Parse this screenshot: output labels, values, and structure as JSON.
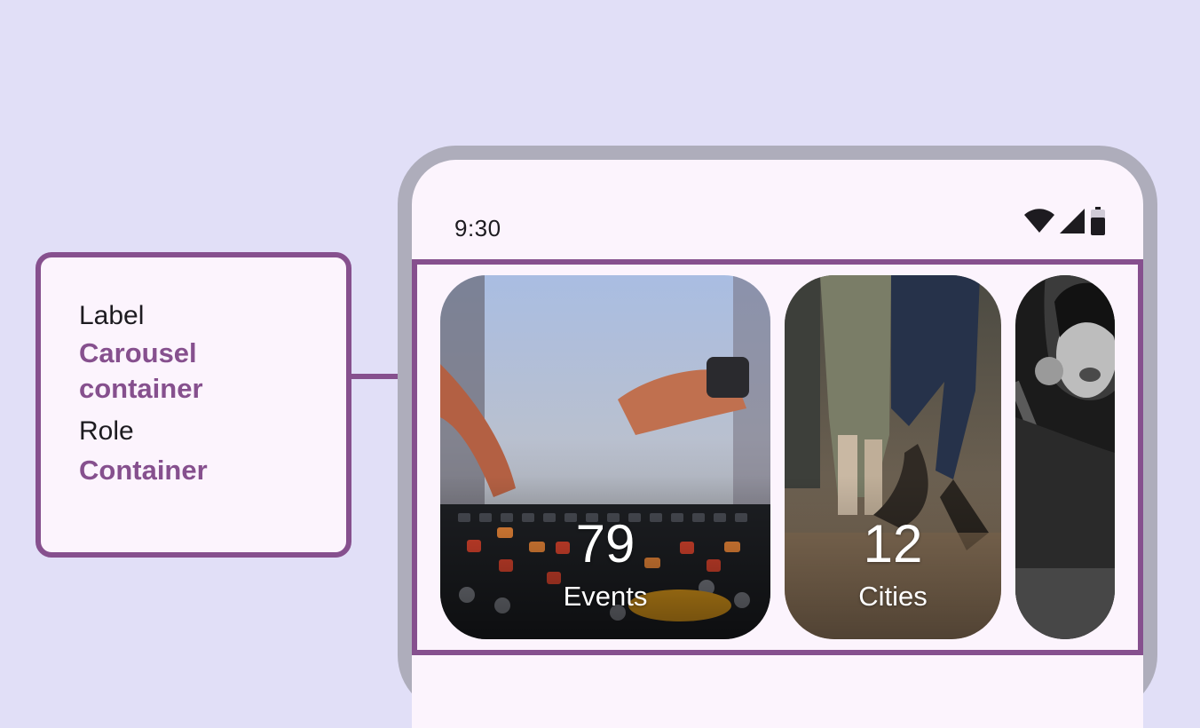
{
  "annotation": {
    "label_key": "Label",
    "label_value": "Carousel container",
    "role_key": "Role",
    "role_value": "Container"
  },
  "status_bar": {
    "time": "9:30",
    "icons": [
      "wifi-icon",
      "cellular-signal-icon",
      "battery-icon"
    ]
  },
  "carousel": {
    "items": [
      {
        "count": "79",
        "label": "Events",
        "image": "dj-mixer-photo"
      },
      {
        "count": "12",
        "label": "Cities",
        "image": "dancing-crowd-photo"
      },
      {
        "image": "singer-microphone-photo"
      }
    ]
  },
  "colors": {
    "background": "#e1dff7",
    "accent": "#86508e",
    "surface": "#fcf4fd",
    "device_frame": "#aeadbb",
    "text": "#1d1b20"
  }
}
